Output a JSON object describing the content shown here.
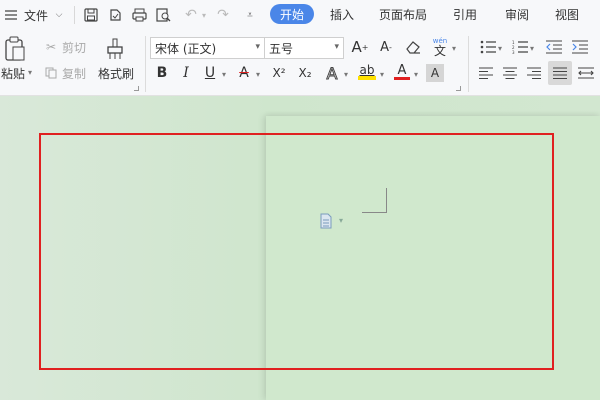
{
  "menubar": {
    "file_label": "文件",
    "tabs": [
      {
        "label": "开始",
        "active": true
      },
      {
        "label": "插入"
      },
      {
        "label": "页面布局"
      },
      {
        "label": "引用"
      },
      {
        "label": "审阅"
      },
      {
        "label": "视图"
      }
    ]
  },
  "ribbon": {
    "clipboard": {
      "paste_label": "粘贴",
      "cut_label": "剪切",
      "copy_label": "复制",
      "format_painter_label": "格式刷"
    },
    "font": {
      "font_name": "宋体 (正文)",
      "font_size": "五号",
      "bold_glyph": "B",
      "italic_glyph": "I",
      "underline_glyph": "U",
      "strike_glyph": "A",
      "superscript_glyph": "X²",
      "subscript_glyph": "X₂",
      "font_effect_glyph": "A",
      "highlight_glyph": "ab",
      "font_color_glyph": "A",
      "char_shading_glyph": "A",
      "grow_glyph": "A",
      "shrink_glyph": "A",
      "phonetic_top": "wén",
      "phonetic_char": "文"
    }
  },
  "colors": {
    "accent": "#4a86e8",
    "highlight_yellow": "#ffe100",
    "font_red": "#e02020",
    "selection_border": "#e02020",
    "page_background": "#d0e8cd"
  }
}
